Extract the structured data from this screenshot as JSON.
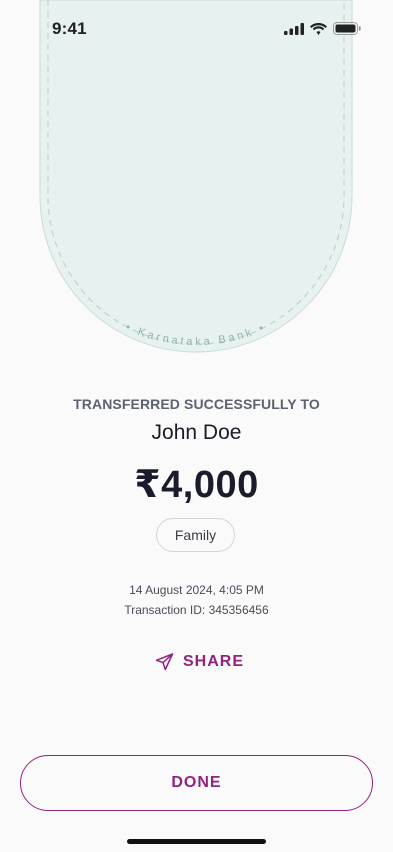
{
  "status_bar": {
    "time": "9:41"
  },
  "banner": {
    "bank_name": "• Karnataka Bank •",
    "fill_color": "#e7f1ef",
    "stroke_color": "#c6ddd9"
  },
  "transfer": {
    "status_label": "TRANSFERRED SUCCESSFULLY TO",
    "recipient_name": "John Doe",
    "amount": "₹4,000",
    "category_tag": "Family",
    "date_time": "14 August 2024, 4:05 PM",
    "transaction_id": "Transaction ID: 345356456"
  },
  "actions": {
    "share_label": "SHARE",
    "done_label": "DONE"
  },
  "colors": {
    "accent": "#93237e",
    "text_primary": "#1c1c28",
    "text_secondary": "#5d6170"
  },
  "icons": {
    "share": "send-icon",
    "signal": "cellular-signal-icon",
    "wifi": "wifi-icon",
    "battery": "battery-icon"
  }
}
